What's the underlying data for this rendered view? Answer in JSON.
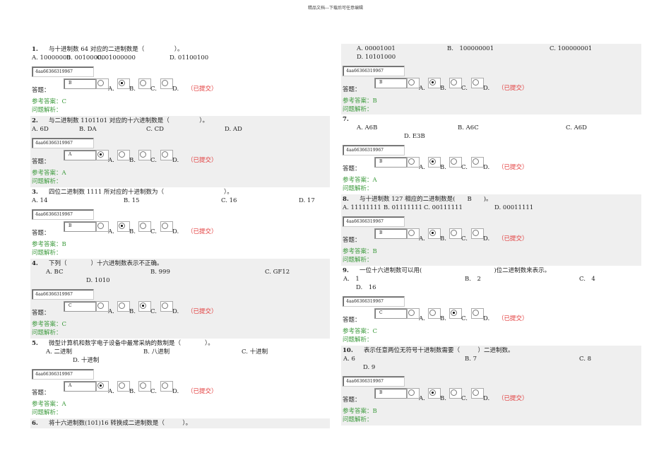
{
  "header": "精品文档---下载后可任意编辑",
  "labels": {
    "answer_prefix": "答题：",
    "submitted": "（已提交）",
    "reference_prefix": "参考答案：",
    "analysis": "问题解析：",
    "radio_labels": [
      "A.",
      "B.",
      "C.",
      "D."
    ]
  },
  "questions": [
    {
      "num": "1.",
      "text": "与十进制数 64 对应的二进制数是（　　　　　）。",
      "options": [
        "A. 10000000",
        "B. 00100000",
        "C. 01000000",
        "D. 01100100"
      ],
      "code": "4aa66366319967",
      "answer_value": "B",
      "selected": "B",
      "reference": "C"
    },
    {
      "num": "2.",
      "text": "与二进制数 1101101 对应的十六进制数是（　　　　　）。",
      "options": [
        "A. 6D",
        "B. DA",
        "C. CD",
        "D. AD"
      ],
      "code": "4aa66366319967",
      "answer_value": "A",
      "selected": "A",
      "reference": "A"
    },
    {
      "num": "3.",
      "text": "四位二进制数 1111 所对应的十进制数为（　　　　　　　　　　）。",
      "options": [
        "A. 14",
        "B. 15",
        "C. 16",
        "D. 17"
      ],
      "code": "4aa66366319967",
      "answer_value": "B",
      "selected": "B",
      "reference": "B"
    },
    {
      "num": "4.",
      "text": "下列（　　　　）十六进制数表示不正确。",
      "options": [
        "A. BC",
        "B. 999",
        "C. GF12",
        "D. 1010"
      ],
      "code": "4aa66366319967",
      "answer_value": "C",
      "selected": "C",
      "reference": "C"
    },
    {
      "num": "5.",
      "text": "微型计算机和数字电子设备中最常采纳的数制是（　　　　）。",
      "options": [
        "A. 二进制",
        "B. 八进制",
        "C. 十进制",
        "D. 十进制"
      ],
      "code": "4aa66366319967",
      "answer_value": "A",
      "selected": "A",
      "reference": "A"
    },
    {
      "num": "6.",
      "text": "将十六进制数(101)16 转换成二进制数是（　　　）。",
      "options": [
        "A. 00001001",
        "B.　100000001",
        "C. 100000001",
        "D. 10101000"
      ],
      "code": "4aa66366319967",
      "answer_value": "B",
      "selected": "B",
      "reference": "B"
    },
    {
      "num": "7.",
      "text": "",
      "options": [
        "A. A6B",
        "B. A6C",
        "C. A6D",
        "D. E3B"
      ],
      "code": "4aa66366319967",
      "answer_value": "B",
      "selected": "B",
      "reference": "A"
    },
    {
      "num": "8.",
      "text": "与十进制数 127 相应的二进制数是(　　B　　)。",
      "options": [
        "A. 11111111",
        "B. 01111111",
        "C. 00111111",
        "D. 00011111"
      ],
      "code": "4aa66366319967",
      "answer_value": "B",
      "selected": "B",
      "reference": "B"
    },
    {
      "num": "9.",
      "text": "一位十六进制数可以用(　　　　　　　　　　　　)位二进制数来表示。",
      "options": [
        "A.　1",
        "B.　2",
        "C.　4",
        "D.　16"
      ],
      "code": "4aa66366319967",
      "answer_value": "C",
      "selected": "C",
      "reference": "C"
    },
    {
      "num": "10.",
      "text": "表示任意两位无符号十进制数需要（　　　）二进制数。",
      "options": [
        "A. 6",
        "B. 7",
        "C. 8",
        "D. 9"
      ],
      "code": "4aa66366319967",
      "answer_value": "B",
      "selected": "B",
      "reference": "B"
    }
  ]
}
